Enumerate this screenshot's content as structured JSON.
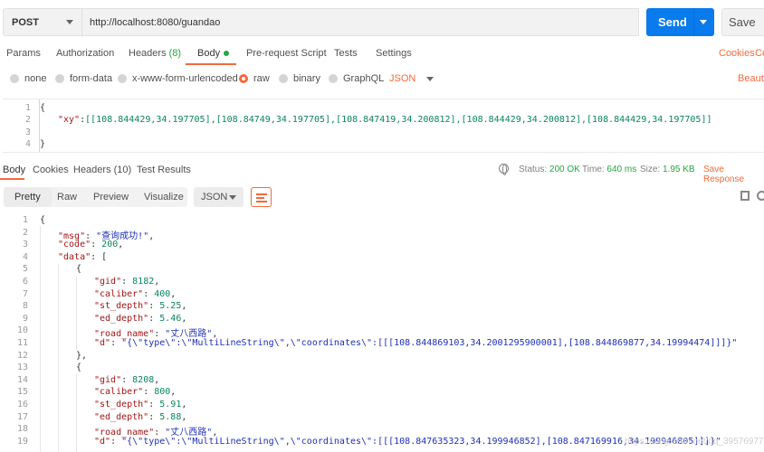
{
  "request": {
    "method": "POST",
    "url": "http://localhost:8080/guandao",
    "send_label": "Send",
    "save_label": "Save"
  },
  "request_tabs": {
    "params": "Params",
    "authorization": "Authorization",
    "headers": "Headers",
    "headers_count": "(8)",
    "body": "Body",
    "prerequest": "Pre-request Script",
    "tests": "Tests",
    "settings": "Settings",
    "cookies": "Cookies",
    "code": "Co"
  },
  "body_options": {
    "none": "none",
    "form_data": "form-data",
    "urlencoded": "x-www-form-urlencoded",
    "raw": "raw",
    "binary": "binary",
    "graphql": "GraphQL",
    "format": "JSON",
    "beautify": "Beauti"
  },
  "request_body": {
    "line_numbers": [
      "1",
      "2",
      "3",
      "4"
    ],
    "line1": "{",
    "line2_key": "\"xy\"",
    "line2_value": "[[108.844429,34.197705],[108.84749,34.197705],[108.847419,34.200812],[108.844429,34.200812],[108.844429,34.197705]]",
    "line4": "}"
  },
  "response_tabs": {
    "body": "Body",
    "cookies": "Cookies",
    "headers": "Headers",
    "headers_count": "(10)",
    "test_results": "Test Results",
    "status_label": "Status:",
    "status_value": "200 OK",
    "time_label": "Time:",
    "time_value": "640 ms",
    "size_label": "Size:",
    "size_value": "1.95 KB",
    "save_response": "Save Response"
  },
  "response_toolbar": {
    "pretty": "Pretty",
    "raw": "Raw",
    "preview": "Preview",
    "visualize": "Visualize",
    "format": "JSON"
  },
  "response_body": {
    "line_numbers": [
      "1",
      "2",
      "3",
      "4",
      "5",
      "6",
      "7",
      "8",
      "9",
      "10",
      "11",
      "12",
      "13",
      "14",
      "15",
      "16",
      "17",
      "18",
      "19"
    ],
    "msg_key": "\"msg\"",
    "msg_value": "\"查询成功!\"",
    "code_key": "\"code\"",
    "code_value": "200",
    "data_key": "\"data\"",
    "items": [
      {
        "gid": "8182",
        "caliber": "400",
        "st_depth": "5.25",
        "ed_depth": "5.46",
        "road_name": "\"丈八西路\"",
        "d": "\"{\\\"type\\\":\\\"MultiLineString\\\",\\\"coordinates\\\":[[[108.844869103,34.2001295900001],[108.844869877,34.19994474]]]}\""
      },
      {
        "gid": "8208",
        "caliber": "800",
        "st_depth": "5.91",
        "ed_depth": "5.88",
        "road_name": "\"丈八西路\"",
        "d": "\"{\\\"type\\\":\\\"MultiLineString\\\",\\\"coordinates\\\":[[[108.847635323,34.199946852],[108.847169916,34.199946805]]]}\""
      }
    ]
  },
  "watermark": "https://blog.csdn.net/qq_39576977"
}
